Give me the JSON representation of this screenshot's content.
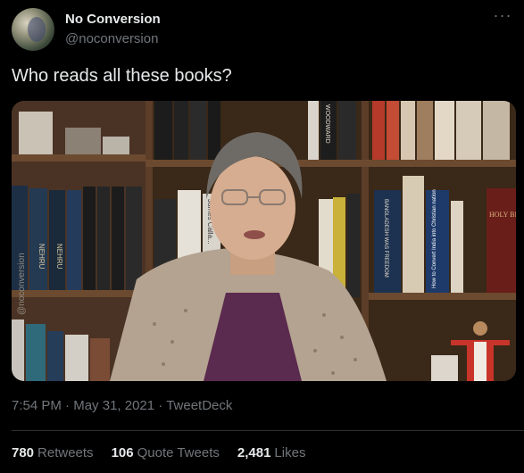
{
  "author": {
    "display_name": "No Conversion",
    "handle": "@noconversion"
  },
  "more_icon": "more-horizontal-icon",
  "tweet": {
    "text": "Who reads all these books?"
  },
  "media": {
    "watermark": "@noconversion",
    "book_spines": {
      "nehru_1": "NEHRU",
      "nehru_2": "NEHRU",
      "james": "James Calla...",
      "woodward": "WOODWARD",
      "freedom": "BANGLADESH WAS FREEDOM",
      "convert": "How to Convert India into Christian nation",
      "holy_bible": "HOLY BIBLE"
    }
  },
  "meta": {
    "time": "7:54 PM",
    "separator": " · ",
    "date": "May 31, 2021",
    "source": "TweetDeck"
  },
  "stats": {
    "retweets_count": "780",
    "retweets_label": "Retweets",
    "quotes_count": "106",
    "quotes_label": "Quote Tweets",
    "likes_count": "2,481",
    "likes_label": "Likes"
  },
  "colors": {
    "background": "#000000",
    "primary_text": "#e7e9ea",
    "secondary_text": "#71767b",
    "divider": "#2f3336"
  }
}
